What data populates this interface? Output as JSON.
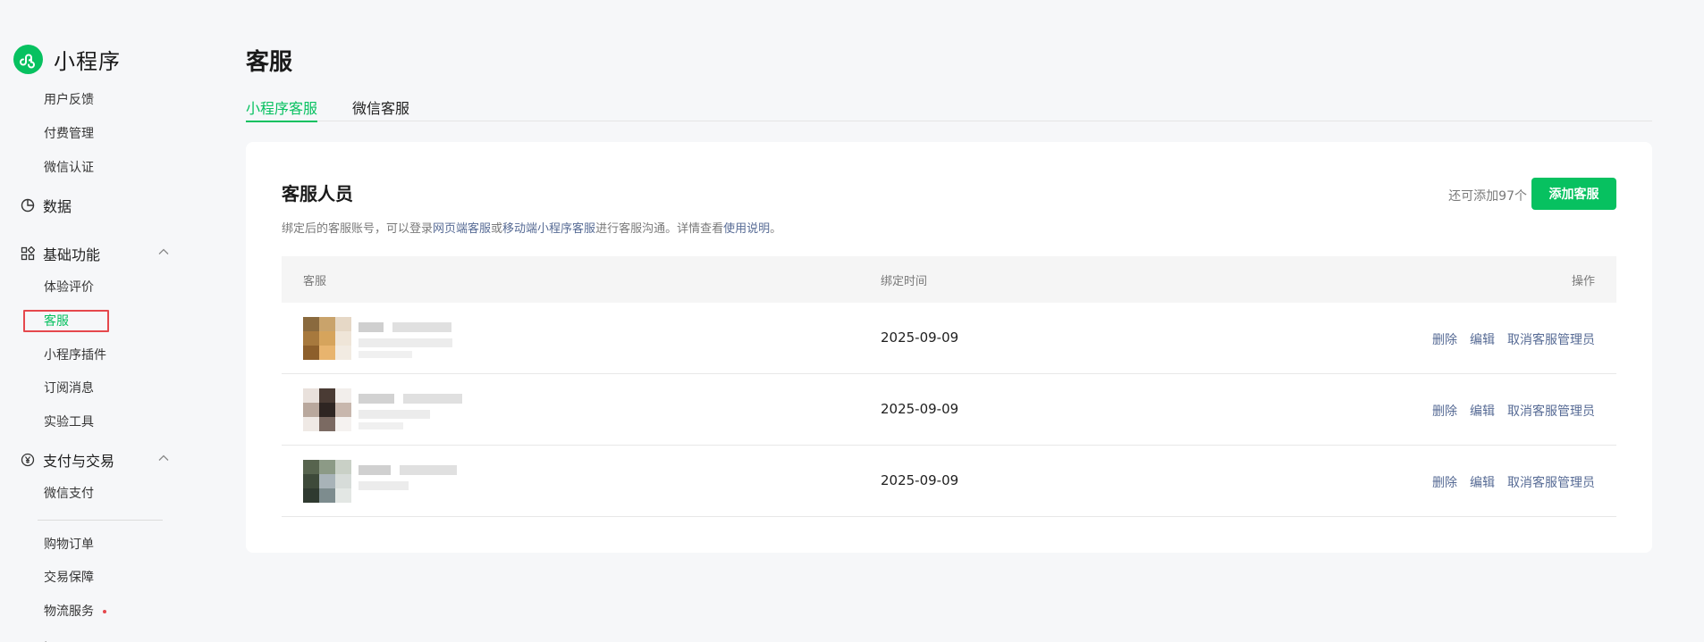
{
  "sidebar": {
    "brand": "小程序",
    "top_items": [
      "用户反馈",
      "付费管理",
      "微信认证"
    ],
    "group_data": "数据",
    "group_basic": "基础功能",
    "basic_items": [
      "体验评价",
      "客服",
      "小程序插件",
      "订阅消息",
      "实验工具"
    ],
    "group_pay": "支付与交易",
    "pay_items": [
      "微信支付",
      "购物订单",
      "交易保障",
      "物流服务"
    ],
    "active_item": "客服",
    "colors": {
      "accent": "#07c160",
      "highlight_border": "#e5484d"
    }
  },
  "page": {
    "title": "客服",
    "tabs": [
      {
        "label": "小程序客服",
        "active": true
      },
      {
        "label": "微信客服",
        "active": false
      }
    ]
  },
  "card": {
    "title": "客服人员",
    "desc_prefix": "绑定后的客服账号，可以登录",
    "desc_link1": "网页端客服",
    "desc_or": "或",
    "desc_link2": "移动端小程序客服",
    "desc_mid": "进行客服沟通。详情查看",
    "desc_link3": "使用说明",
    "desc_end": "。",
    "remaining": "还可添加97个",
    "add_button": "添加客服"
  },
  "table": {
    "columns": [
      "客服",
      "绑定时间",
      "操作"
    ],
    "rows": [
      {
        "bind_time": "2025-09-09",
        "actions": [
          "删除",
          "编辑",
          "取消客服管理员"
        ]
      },
      {
        "bind_time": "2025-09-09",
        "actions": [
          "删除",
          "编辑",
          "取消客服管理员"
        ]
      },
      {
        "bind_time": "2025-09-09",
        "actions": [
          "删除",
          "编辑",
          "取消客服管理员"
        ]
      }
    ]
  },
  "icons": [
    "miniprogram-logo-icon",
    "pie-chart-icon",
    "grid-apps-icon",
    "yuan-coin-icon",
    "chevron-up-icon",
    "notification-dot-icon"
  ]
}
